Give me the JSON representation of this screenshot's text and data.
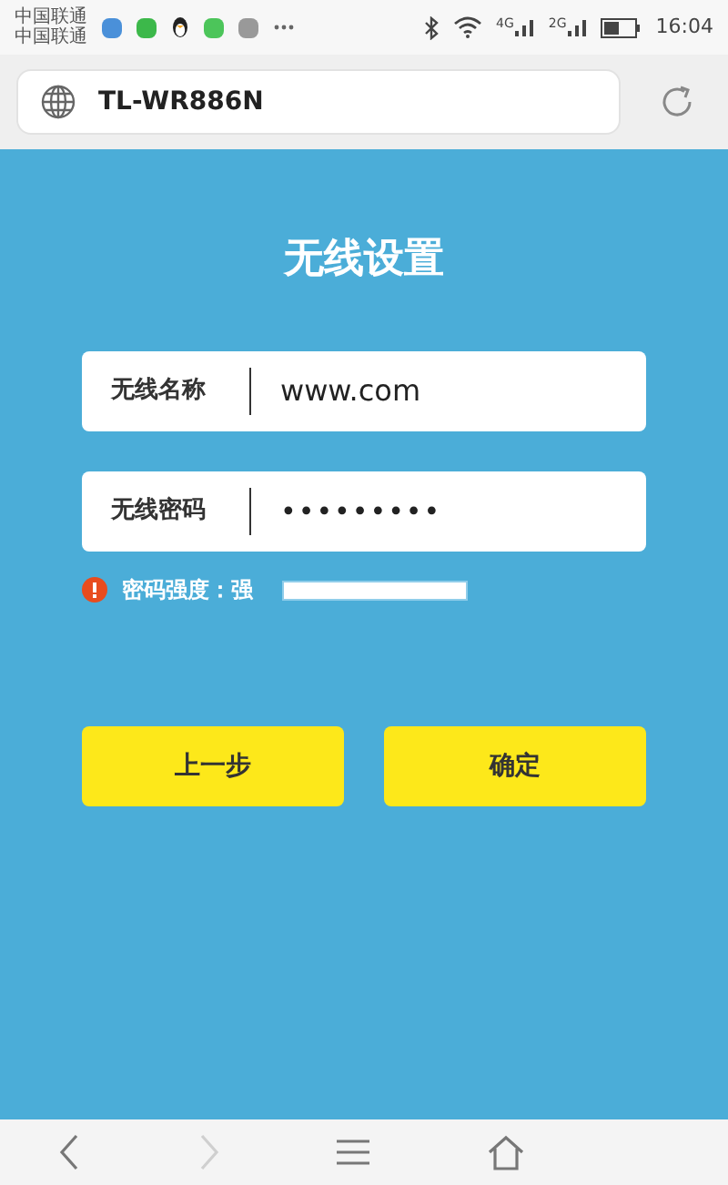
{
  "status_bar": {
    "carriers": [
      "中国联通",
      "中国联通"
    ],
    "network_labels": [
      "4G",
      "2G"
    ],
    "time": "16:04"
  },
  "address_bar": {
    "url": "TL-WR886N"
  },
  "page": {
    "title": "无线设置",
    "fields": [
      {
        "label": "无线名称",
        "value": "www.com",
        "kind": "text"
      },
      {
        "label": "无线密码",
        "value": "•••••••••",
        "kind": "password"
      }
    ],
    "strength": {
      "label": "密码强度：强",
      "level": 1
    },
    "buttons": [
      {
        "label": "上一步"
      },
      {
        "label": "确定"
      }
    ]
  },
  "nav": [
    {
      "kind": "back",
      "disabled": false
    },
    {
      "kind": "forward",
      "disabled": true
    },
    {
      "kind": "menu",
      "disabled": false
    },
    {
      "kind": "home",
      "disabled": false
    }
  ]
}
